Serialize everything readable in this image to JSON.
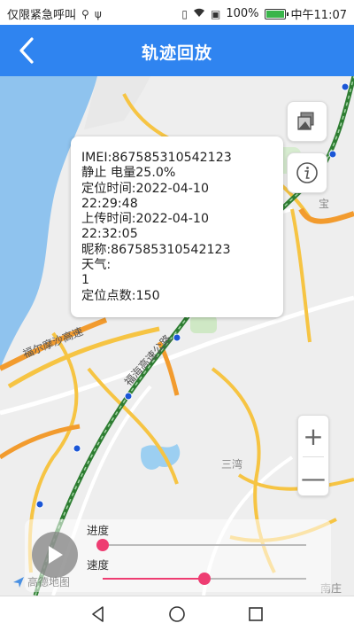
{
  "status_bar": {
    "carrier_text": "仅限紧急呼叫",
    "battery": "100%",
    "time": "中午11:07"
  },
  "header": {
    "title": "轨迹回放",
    "back_icon": "chevron-left-icon"
  },
  "info_popup": {
    "lines": [
      "IMEI:867585310542123",
      "静止 电量25.0%",
      "定位时间:2022-04-10",
      "22:29:48",
      "上传时间:2022-04-10",
      "22:32:05",
      "昵称:867585310542123",
      "天气:",
      "1",
      "定位点数:150"
    ]
  },
  "map": {
    "labels": {
      "road1": "福尔摩沙高速",
      "road2": "福海高速公路",
      "place1": "宝",
      "place2": "三湾",
      "place3": "南庄"
    },
    "logo_text": "高德地图"
  },
  "zoom": {
    "plus": "+",
    "minus": "—"
  },
  "playback": {
    "progress_label": "进度",
    "speed_label": "速度",
    "progress_value": 0,
    "speed_value": 0.5
  },
  "colors": {
    "header": "#2f84f0",
    "slider": "#ee3d72",
    "track": "#2e7d32"
  }
}
